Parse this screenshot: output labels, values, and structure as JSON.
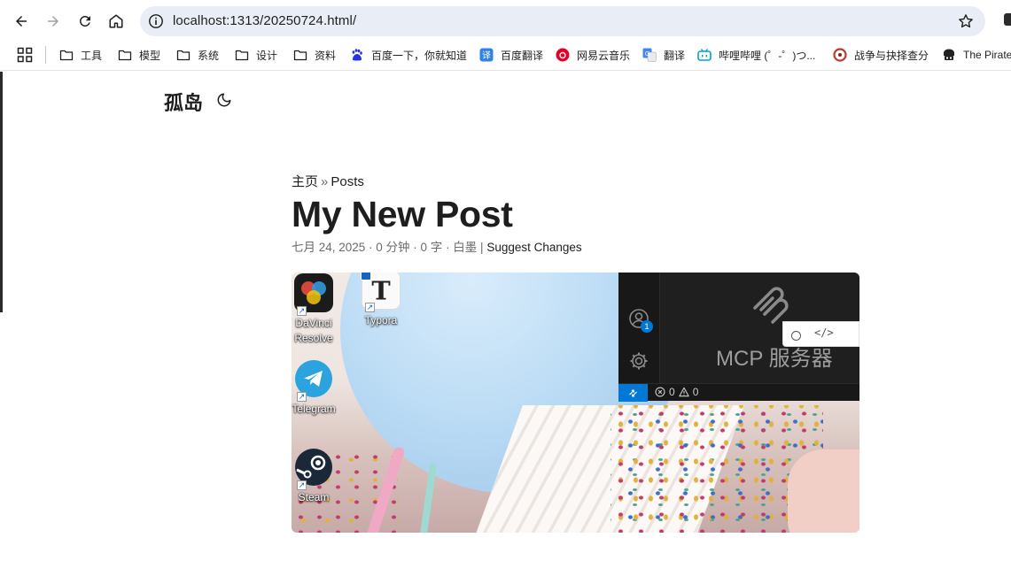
{
  "browser": {
    "url": "localhost:1313/20250724.html/",
    "bookmarks": [
      {
        "label": "工具",
        "icon": "folder-icon"
      },
      {
        "label": "模型",
        "icon": "folder-icon"
      },
      {
        "label": "系统",
        "icon": "folder-icon"
      },
      {
        "label": "设计",
        "icon": "folder-icon"
      },
      {
        "label": "资料",
        "icon": "folder-icon"
      },
      {
        "label": "百度一下，你就知道",
        "icon": "baidu-icon"
      },
      {
        "label": "百度翻译",
        "icon": "baidu-translate-icon"
      },
      {
        "label": "网易云音乐",
        "icon": "netease-music-icon"
      },
      {
        "label": "翻译",
        "icon": "google-translate-icon"
      },
      {
        "label": "哔哩哔哩 (゜-゜)つ...",
        "icon": "bilibili-icon"
      },
      {
        "label": "战争与抉择查分",
        "icon": "game-score-icon"
      },
      {
        "label": "The Pirate",
        "icon": "pirate-icon"
      }
    ]
  },
  "site": {
    "title": "孤岛"
  },
  "post": {
    "breadcrumb_home": "主页",
    "breadcrumb_sep": "»",
    "breadcrumb_section": "Posts",
    "title": "My New Post",
    "meta": "七月 24, 2025 · 0 分钟 · 0 字 · 白墨 | ",
    "suggest": "Suggest Changes"
  },
  "cover": {
    "desktop_icons": [
      {
        "label": "DaVinci Resolve",
        "icon": "davinci-resolve-icon"
      },
      {
        "label": "Typora",
        "icon": "typora-icon"
      },
      {
        "label": "Telegram",
        "icon": "telegram-icon"
      },
      {
        "label": "Steam",
        "icon": "steam-icon"
      }
    ],
    "vscode": {
      "heading": "MCP 服务器",
      "account_badge": "1",
      "errors": "0",
      "warnings": "0",
      "popup_code": "</>"
    }
  },
  "colors": {
    "omnibox_bg": "#e9eef6",
    "vscode_accent": "#0078d4",
    "text": "#1e1e1e",
    "meta_text": "#6b6b6b"
  }
}
